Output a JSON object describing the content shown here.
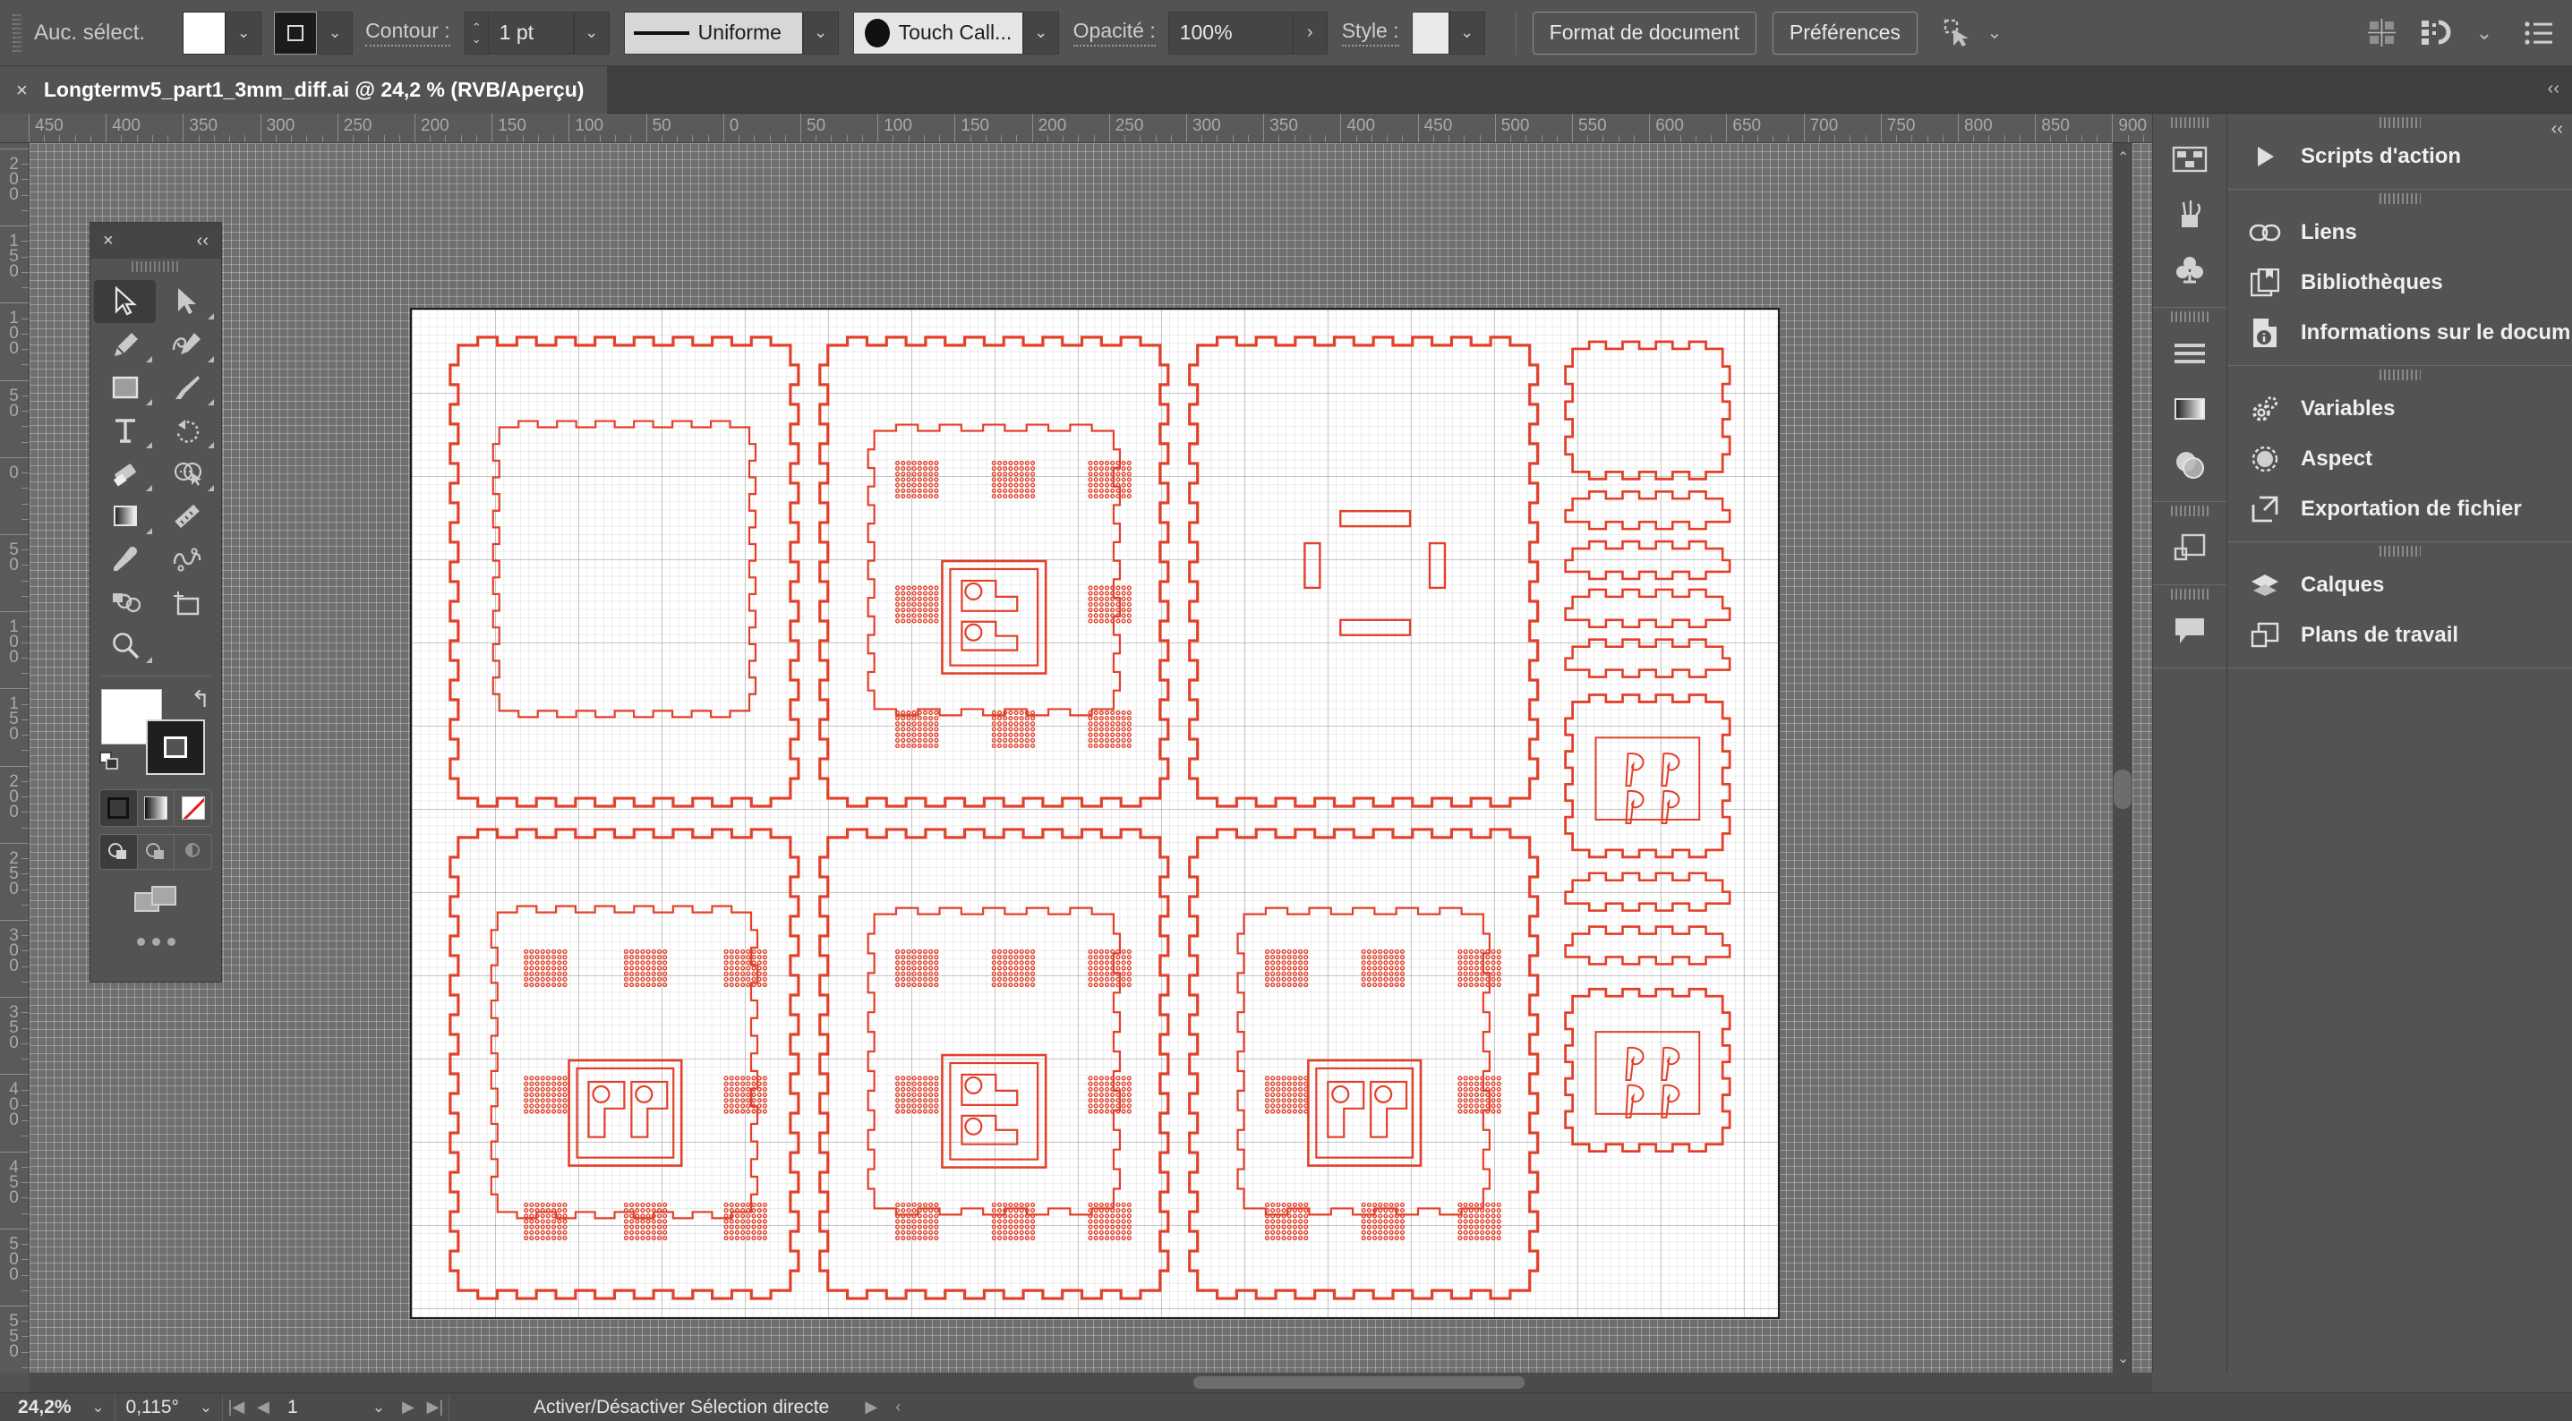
{
  "app": {
    "name": "Adobe Illustrator",
    "accent_red": "#e2402a",
    "panel_bg": "#535353",
    "canvas_bg": "#6f6f6f"
  },
  "topbar": {
    "selection_label": "Auc. sélect.",
    "fill_swatch": "#ffffff",
    "stroke_swatch": "#1b1b1b",
    "stroke_label": "Contour :",
    "stroke_weight": "1 pt",
    "stroke_profile": "Uniforme",
    "brush_definition": "Touch Call...",
    "opacity_label": "Opacité :",
    "opacity_value": "100%",
    "style_label": "Style :",
    "document_setup_button": "Format de document",
    "preferences_button": "Préférences",
    "icons": {
      "fill_dropdown": "chevron-down-icon",
      "stroke_dropdown": "chevron-down-icon",
      "weight_stepper": "stepper-icon",
      "weight_dropdown": "chevron-down-icon",
      "profile_dropdown": "chevron-down-icon",
      "brush_dropdown": "chevron-down-icon",
      "opacity_arrow": "chevron-right-icon",
      "style_dropdown": "chevron-down-icon",
      "transform_dropdown": "chevron-down-icon",
      "align": "align-icon",
      "distribute": "distribute-icon",
      "menu": "list-menu-icon"
    }
  },
  "tab": {
    "close": "×",
    "title": "Longtermv5_part1_3mm_diff.ai @ 24,2 % (RVB/Aperçu)"
  },
  "rulers": {
    "horizontal": [
      "450",
      "400",
      "350",
      "300",
      "250",
      "200",
      "150",
      "100",
      "50",
      "0",
      "50",
      "100",
      "150",
      "200",
      "250",
      "300",
      "350",
      "400",
      "450",
      "500",
      "550",
      "600",
      "650",
      "700",
      "750",
      "800",
      "850",
      "900"
    ],
    "vertical": [
      "200",
      "150",
      "100",
      "50",
      "0",
      "50",
      "100",
      "150",
      "200",
      "250",
      "300",
      "350",
      "400",
      "450",
      "500",
      "550"
    ]
  },
  "tools": {
    "close": "×",
    "collapse": "‹‹",
    "items": [
      {
        "name": "selection-tool",
        "active": true
      },
      {
        "name": "direct-selection-tool",
        "active": false
      },
      {
        "name": "pen-tool",
        "active": false
      },
      {
        "name": "curvature-tool",
        "active": false
      },
      {
        "name": "rectangle-tool",
        "active": false
      },
      {
        "name": "paintbrush-tool",
        "active": false
      },
      {
        "name": "type-tool",
        "active": false
      },
      {
        "name": "rotate-tool",
        "active": false
      },
      {
        "name": "eraser-tool",
        "active": false
      },
      {
        "name": "shape-builder-tool",
        "active": false
      },
      {
        "name": "gradient-tool",
        "active": false
      },
      {
        "name": "measure-tool",
        "active": false
      },
      {
        "name": "eyedropper-tool",
        "active": false
      },
      {
        "name": "scissors-tool",
        "active": false
      },
      {
        "name": "blend-tool",
        "active": false
      },
      {
        "name": "artboard-tool",
        "active": false
      },
      {
        "name": "zoom-tool",
        "active": false
      }
    ],
    "fill_color": "#ffffff",
    "stroke_color": "#1f1f1f",
    "paint_modes": [
      {
        "name": "color-mode",
        "on": true
      },
      {
        "name": "gradient-mode",
        "on": false
      },
      {
        "name": "none-mode",
        "on": false
      }
    ],
    "draw_modes": [
      {
        "name": "draw-normal",
        "on": true
      },
      {
        "name": "draw-behind",
        "on": false
      },
      {
        "name": "draw-inside",
        "on": false
      }
    ]
  },
  "rail": {
    "groups": [
      {
        "items": [
          {
            "name": "artboards-icon"
          },
          {
            "name": "brushes-icon"
          },
          {
            "name": "symbols-icon"
          }
        ]
      },
      {
        "items": [
          {
            "name": "align-lines-icon"
          },
          {
            "name": "gradient-icon"
          },
          {
            "name": "transparency-icon"
          }
        ]
      },
      {
        "items": [
          {
            "name": "artboard-panel-icon"
          }
        ]
      },
      {
        "items": [
          {
            "name": "comments-icon"
          }
        ]
      }
    ]
  },
  "right_panel": {
    "collapse": "‹‹",
    "groups": [
      {
        "items": [
          {
            "label": "Scripts d'action",
            "icon": "play-triangle-icon"
          }
        ]
      },
      {
        "items": [
          {
            "label": "Liens",
            "icon": "link-chain-icon"
          },
          {
            "label": "Bibliothèques",
            "icon": "libraries-icon"
          },
          {
            "label": "Informations sur le docum…",
            "icon": "document-info-icon"
          }
        ]
      },
      {
        "items": [
          {
            "label": "Variables",
            "icon": "gears-icon"
          },
          {
            "label": "Aspect",
            "icon": "appearance-circle-icon"
          },
          {
            "label": "Exportation de fichier",
            "icon": "export-arrow-icon"
          }
        ]
      },
      {
        "items": [
          {
            "label": "Calques",
            "icon": "layers-icon"
          },
          {
            "label": "Plans de travail",
            "icon": "artboards-stack-icon"
          }
        ]
      }
    ]
  },
  "statusbar": {
    "zoom": "24,2%",
    "rotation": "0,115°",
    "artboard_number": "1",
    "message": "Activer/Désactiver Sélection directe",
    "icons": {
      "zoom_dropdown": "chevron-down-icon",
      "rotation_dropdown": "chevron-down-icon",
      "first_artboard": "first-icon",
      "prev_artboard": "prev-icon",
      "artboard_dropdown": "chevron-down-icon",
      "next_artboard": "next-icon",
      "last_artboard": "last-icon",
      "status_menu": "play-icon",
      "status_resize": "chevron-left-icon"
    }
  },
  "artwork": {
    "description": "Laser-cut vector layout: red 1pt outlines of castellated (puzzle-edge) square tiles on a graph-paper artboard",
    "stroke_color": "#e2402a",
    "artboard_border": "#1c1c1c",
    "tiles": [
      {
        "name": "tile-top-left",
        "row": 0,
        "col": 0,
        "content": "nested-empty-frame"
      },
      {
        "name": "tile-top-mid",
        "row": 0,
        "col": 1,
        "content": "dot-grid-8-with-center-glyph-pl"
      },
      {
        "name": "tile-top-right",
        "row": 0,
        "col": 2,
        "content": "four-bars"
      },
      {
        "name": "tile-bottom-left",
        "row": 1,
        "col": 0,
        "content": "dot-grid-8-with-center-glyph-pp"
      },
      {
        "name": "tile-bottom-mid",
        "row": 1,
        "col": 1,
        "content": "dot-grid-8-with-center-glyph-pl"
      },
      {
        "name": "tile-bottom-right",
        "row": 1,
        "col": 2,
        "content": "dot-grid-8-with-center-glyph-pp"
      }
    ],
    "side_strip": [
      {
        "name": "side-tile-1",
        "type": "square-empty"
      },
      {
        "name": "side-strip-1",
        "type": "bar"
      },
      {
        "name": "side-strip-2",
        "type": "bar"
      },
      {
        "name": "side-strip-3",
        "type": "bar"
      },
      {
        "name": "side-strip-4",
        "type": "bar"
      },
      {
        "name": "side-tile-2",
        "type": "square-with-four-hooks"
      },
      {
        "name": "side-strip-5",
        "type": "bar"
      },
      {
        "name": "side-strip-6",
        "type": "bar"
      },
      {
        "name": "side-tile-3",
        "type": "square-with-four-hooks"
      }
    ]
  }
}
